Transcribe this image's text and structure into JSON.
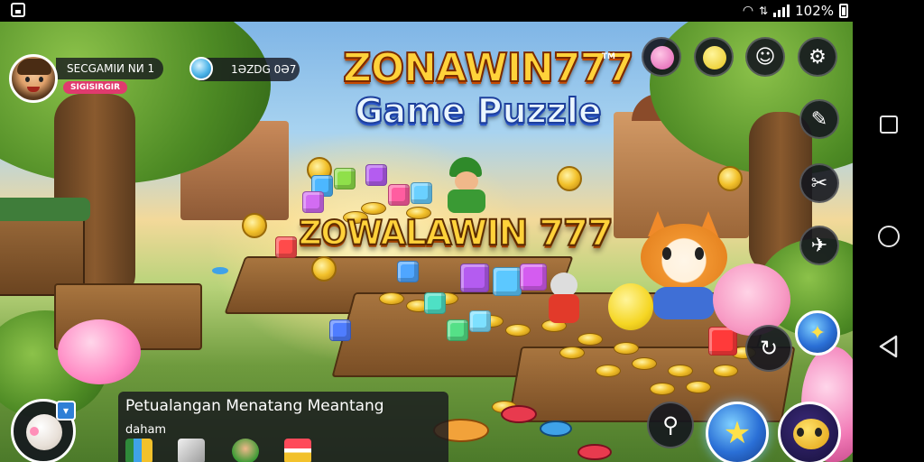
{
  "status_bar": {
    "battery": "102%"
  },
  "player": {
    "name": "SEСGAMIИ NИ 1",
    "tag": "SIGISIRGIR"
  },
  "currency": {
    "value": "1ӘZDG 0Ә7"
  },
  "logo": {
    "title": "ZONAWIN777",
    "subtitle": "Game Puzzle",
    "tm": "TM"
  },
  "scene_sign": {
    "text": "ZOWALAWIN 777"
  },
  "info_panel": {
    "title": "Petualangan Menatang Meantang",
    "subtitle": "daham"
  },
  "right_menu": {
    "icons": [
      "pet-pink-icon",
      "pet-yellow-icon",
      "chat-icon",
      "gear-icon",
      "wrench-icon",
      "scissors-icon",
      "plane-icon",
      "magic-wand-icon",
      "refresh-icon"
    ]
  },
  "colors": {
    "accent_gold": "#ffd23a",
    "accent_blue": "#2a6fd6",
    "panel_bg": "#19191e"
  }
}
